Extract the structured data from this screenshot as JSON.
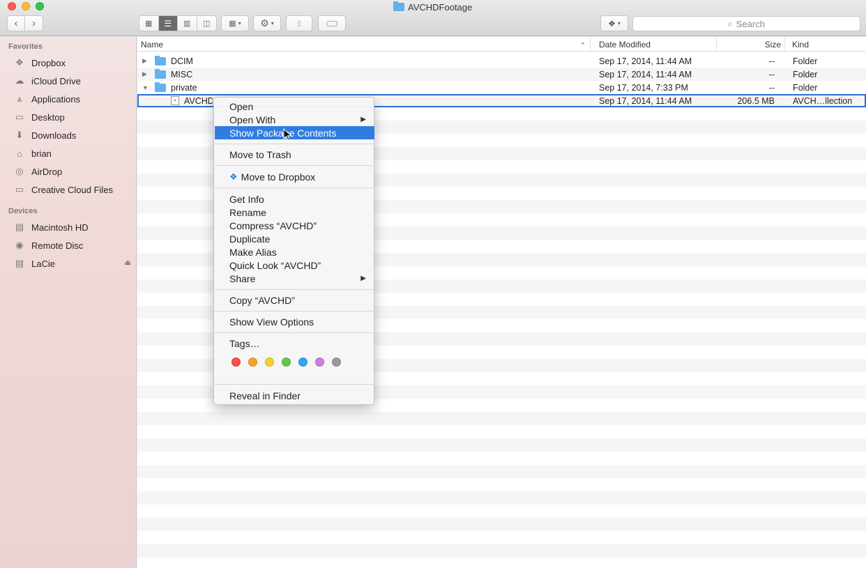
{
  "window": {
    "title": "AVCHDFootage"
  },
  "toolbar": {
    "search_placeholder": "Search",
    "view_buttons": [
      "icon-view-icon",
      "list-view-icon",
      "column-view-icon",
      "cover-flow-icon"
    ]
  },
  "sidebar": {
    "favorites_label": "Favorites",
    "favorites": [
      {
        "label": "Dropbox",
        "icon": "dropbox-icon"
      },
      {
        "label": "iCloud Drive",
        "icon": "cloud-icon"
      },
      {
        "label": "Applications",
        "icon": "applications-icon"
      },
      {
        "label": "Desktop",
        "icon": "desktop-icon"
      },
      {
        "label": "Downloads",
        "icon": "downloads-icon"
      },
      {
        "label": "brian",
        "icon": "home-icon"
      },
      {
        "label": "AirDrop",
        "icon": "airdrop-icon"
      },
      {
        "label": "Creative Cloud Files",
        "icon": "folder-icon"
      }
    ],
    "devices_label": "Devices",
    "devices": [
      {
        "label": "Macintosh HD",
        "icon": "hard-drive-icon"
      },
      {
        "label": "Remote Disc",
        "icon": "disc-icon"
      },
      {
        "label": "LaCie",
        "icon": "external-drive-icon"
      }
    ]
  },
  "list": {
    "columns": {
      "name": "Name",
      "date": "Date Modified",
      "size": "Size",
      "kind": "Kind"
    },
    "rows": [
      {
        "name": "DCIM",
        "date": "Sep 17, 2014, 11:44 AM",
        "size": "--",
        "kind": "Folder",
        "type": "folder",
        "disclosure": "collapsed"
      },
      {
        "name": "MISC",
        "date": "Sep 17, 2014, 11:44 AM",
        "size": "--",
        "kind": "Folder",
        "type": "folder",
        "disclosure": "collapsed"
      },
      {
        "name": "private",
        "date": "Sep 17, 2014, 7:33 PM",
        "size": "--",
        "kind": "Folder",
        "type": "folder",
        "disclosure": "expanded"
      },
      {
        "name": "AVCHD",
        "date": "Sep 17, 2014, 11:44 AM",
        "size": "206.5 MB",
        "kind": "AVCH…llection",
        "type": "package",
        "selected": true
      }
    ]
  },
  "context_menu": {
    "items": {
      "open": "Open",
      "open_with": "Open With",
      "show_package_contents": "Show Package Contents",
      "move_to_trash": "Move to Trash",
      "move_to_dropbox": "Move to Dropbox",
      "get_info": "Get Info",
      "rename": "Rename",
      "compress": "Compress “AVCHD”",
      "duplicate": "Duplicate",
      "make_alias": "Make Alias",
      "quick_look": "Quick Look “AVCHD”",
      "share": "Share",
      "copy": "Copy “AVCHD”",
      "show_view_options": "Show View Options",
      "tags": "Tags…",
      "reveal_in_finder": "Reveal in Finder"
    },
    "highlighted": "show_package_contents",
    "tag_colors": [
      "#fc4f4b",
      "#f6a12c",
      "#f5d12a",
      "#63c84a",
      "#35a6ef",
      "#c97ee0",
      "#9a9a9a"
    ]
  }
}
